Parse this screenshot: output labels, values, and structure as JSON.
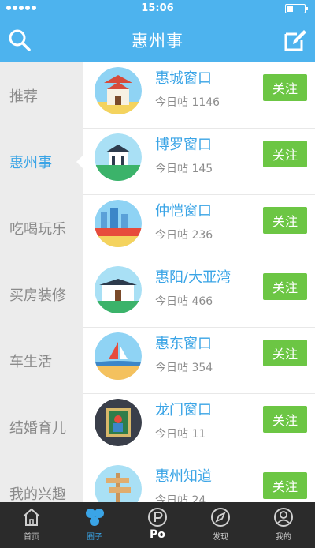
{
  "status": {
    "time": "15:06"
  },
  "header": {
    "title": "惠州事",
    "search_icon": "search-icon",
    "edit_icon": "compose-icon"
  },
  "sidebar": {
    "items": [
      {
        "label": "推荐",
        "active": false
      },
      {
        "label": "惠州事",
        "active": true
      },
      {
        "label": "吃喝玩乐",
        "active": false
      },
      {
        "label": "买房装修",
        "active": false
      },
      {
        "label": "车生活",
        "active": false
      },
      {
        "label": "结婚育儿",
        "active": false
      },
      {
        "label": "我的兴趣",
        "active": false
      }
    ]
  },
  "list": {
    "follow_label": "关注",
    "rows": [
      {
        "name": "惠城窗口",
        "count": "今日帖 1146"
      },
      {
        "name": "博罗窗口",
        "count": "今日帖 145"
      },
      {
        "name": "仲恺窗口",
        "count": "今日帖 236"
      },
      {
        "name": "惠阳/大亚湾",
        "count": "今日帖 466"
      },
      {
        "name": "惠东窗口",
        "count": "今日帖 354"
      },
      {
        "name": "龙门窗口",
        "count": "今日帖 11"
      },
      {
        "name": "惠州知道",
        "count": "今日帖 24"
      }
    ]
  },
  "tabbar": {
    "tabs": [
      {
        "label": "首页",
        "icon": "home-icon",
        "active": false
      },
      {
        "label": "圈子",
        "icon": "circles-icon",
        "active": true
      },
      {
        "label": "Po",
        "icon": "po-icon",
        "active": false
      },
      {
        "label": "发现",
        "icon": "compass-icon",
        "active": false
      },
      {
        "label": "我的",
        "icon": "profile-icon",
        "active": false
      }
    ]
  },
  "colors": {
    "header": "#4db3ee",
    "accent": "#3aa4e6",
    "follow": "#6cc644",
    "sidebar": "#ececec",
    "tabbar": "#2b2b2b"
  }
}
